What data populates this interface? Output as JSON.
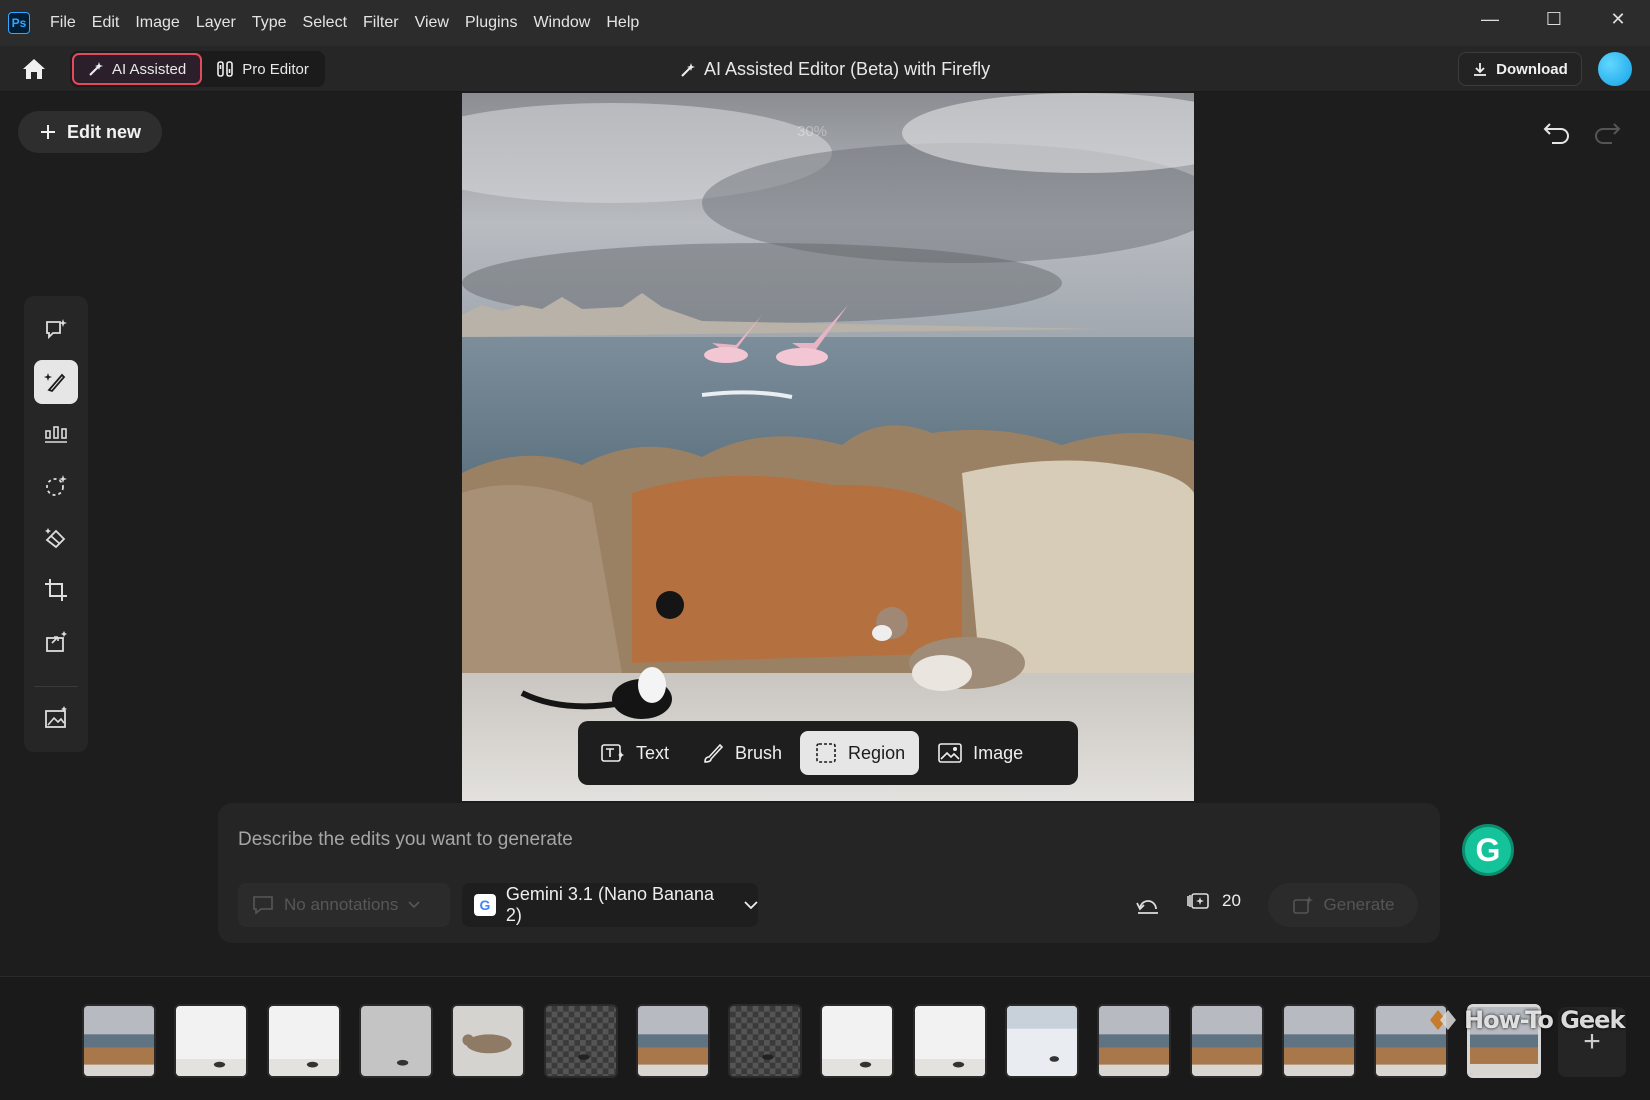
{
  "app": {
    "logo_text": "Ps"
  },
  "menu": [
    "File",
    "Edit",
    "Image",
    "Layer",
    "Type",
    "Select",
    "Filter",
    "View",
    "Plugins",
    "Window",
    "Help"
  ],
  "window_controls": {
    "minimize": "—",
    "maximize": "☐",
    "close": "✕"
  },
  "header": {
    "ai_assisted_label": "AI Assisted",
    "pro_editor_label": "Pro Editor",
    "title": "AI Assisted Editor (Beta) with Firefly",
    "download_label": "Download"
  },
  "edit_new_label": "Edit new",
  "canvas": {
    "zoom_label": "30%"
  },
  "edit_modes": [
    {
      "label": "Text",
      "active": false
    },
    {
      "label": "Brush",
      "active": false
    },
    {
      "label": "Region",
      "active": true
    },
    {
      "label": "Image",
      "active": false
    }
  ],
  "prompt": {
    "placeholder": "Describe the edits you want to generate",
    "annotations_label": "No annotations",
    "model_label": "Gemini 3.1 (Nano Banana 2)",
    "model_badge": "G",
    "credits": "20",
    "generate_label": "Generate"
  },
  "grammarly_badge": "G",
  "filmstrip": {
    "thumbnails": [
      "beach-scene",
      "white-scene",
      "white-scene",
      "gray-scene",
      "cat-closeup",
      "transparent",
      "beach-scene",
      "transparent",
      "white-scene",
      "white-scene",
      "snow-scene",
      "beach-scene",
      "beach-scene",
      "beach-scene",
      "beach-scene",
      "beach-scene"
    ],
    "selected_index": 15,
    "add_label": "+"
  },
  "watermark": "How-To Geek",
  "colors": {
    "accent_outline": "#e34a5c",
    "avatar": "#13a3e6",
    "grammarly": "#15c39a",
    "canvas_bg": "#1d1d1d"
  }
}
